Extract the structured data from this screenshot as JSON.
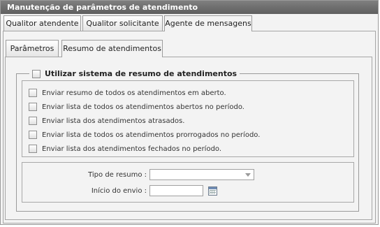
{
  "window": {
    "title": "Manutenção de parâmetros de atendimento"
  },
  "outer_tabs": [
    {
      "label": "Qualitor atendente",
      "active": false
    },
    {
      "label": "Qualitor solicitante",
      "active": false
    },
    {
      "label": "Agente de mensagens",
      "active": true
    }
  ],
  "inner_tabs": [
    {
      "label": "Parâmetros",
      "active": false
    },
    {
      "label": "Resumo de atendimentos",
      "active": true
    }
  ],
  "summary": {
    "enable_label": "Utilizar sistema de resumo de atendimentos",
    "enable_checked": false,
    "options": [
      {
        "label": "Enviar resumo de todos os atendimentos em aberto.",
        "checked": false
      },
      {
        "label": "Enviar lista de todos os atendimentos abertos no período.",
        "checked": false
      },
      {
        "label": "Enviar lista dos atendimentos atrasados.",
        "checked": false
      },
      {
        "label": "Enviar lista de todos os atendimentos prorrogados no período.",
        "checked": false
      },
      {
        "label": "Enviar lista dos atendimentos fechados no período.",
        "checked": false
      }
    ],
    "summary_type": {
      "label": "Tipo de resumo :",
      "value": ""
    },
    "send_start": {
      "label": "Início do envio :",
      "value": ""
    }
  },
  "colors": {
    "titlebar": "#6f6f6f",
    "panel_bg": "#f3f3f3",
    "border": "#9a9a9a"
  }
}
